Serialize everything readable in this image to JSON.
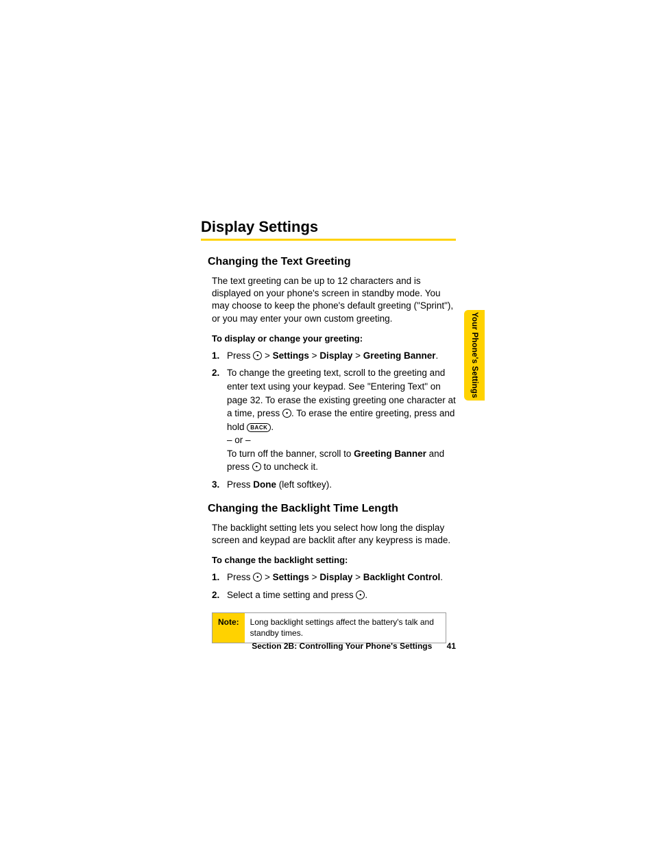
{
  "page_title": "Display Settings",
  "side_tab": "Your Phone's Settings",
  "section1": {
    "heading": "Changing the Text Greeting",
    "intro": "The text greeting can be up to 12 characters and is displayed on your phone's screen in standby mode. You may choose to keep the phone's default greeting (\"Sprint\"), or you may enter your own custom greeting.",
    "lead": "To display or change your greeting:",
    "step1_a": "Press ",
    "step1_b": " > ",
    "step1_settings": "Settings",
    "step1_display": "Display",
    "step1_greeting": "Greeting Banner",
    "step1_end": ".",
    "step2_a": "To change the greeting text, scroll to the greeting and enter text using your keypad. See \"Entering Text\" on page 32. To erase the existing greeting one character at a time, press ",
    "step2_b": ". To erase the entire greeting, press and hold ",
    "step2_back": "BACK",
    "step2_c": ".",
    "step2_or": "– or –",
    "step2_d": "To turn off the banner, scroll to ",
    "step2_gb": "Greeting Banner",
    "step2_e": " and press ",
    "step2_f": " to uncheck it.",
    "step3_a": "Press ",
    "step3_done": "Done",
    "step3_b": " (left softkey)."
  },
  "section2": {
    "heading": "Changing the Backlight Time Length",
    "intro": "The backlight setting lets you select how long the display screen and keypad are backlit after any keypress is made.",
    "lead": "To change the backlight setting:",
    "step1_a": "Press ",
    "step1_sep": " > ",
    "step1_settings": "Settings",
    "step1_display": "Display",
    "step1_bc": "Backlight Control",
    "step1_end": ".",
    "step2_a": "Select a time setting and press ",
    "step2_b": "."
  },
  "note": {
    "label": "Note:",
    "text": "Long backlight settings affect the battery's talk and standby times."
  },
  "footer": {
    "section": "Section 2B: Controlling Your Phone's Settings",
    "page": "41"
  }
}
